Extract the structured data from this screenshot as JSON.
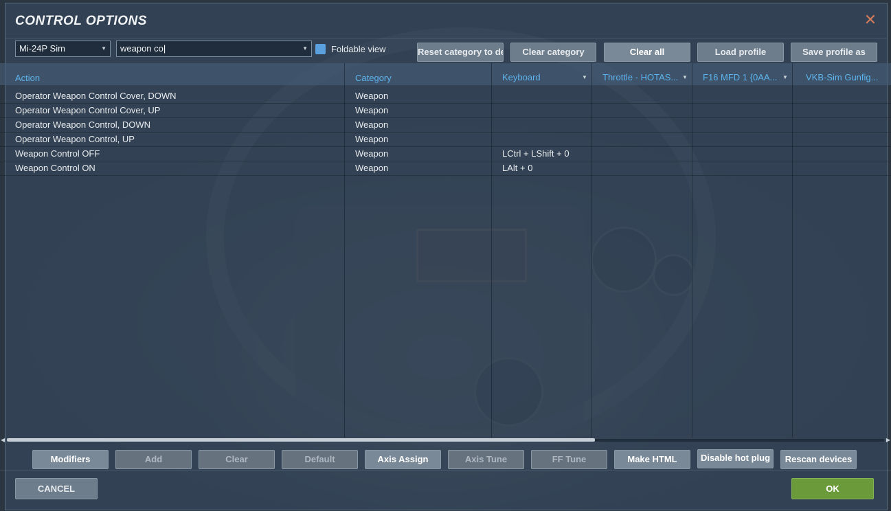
{
  "window": {
    "title": "CONTROL OPTIONS"
  },
  "toolbar": {
    "aircraft": "Mi-24P Sim",
    "search_value": "weapon co",
    "foldable_label": "Foldable view",
    "reset_category": "Reset category to default",
    "clear_category": "Clear category",
    "clear_all": "Clear all",
    "load_profile": "Load profile",
    "save_profile": "Save profile as"
  },
  "table": {
    "columns": [
      "Action",
      "Category",
      "Keyboard",
      "Throttle - HOTAS...",
      "F16 MFD 1 {0AA...",
      "VKB-Sim Gunfig..."
    ],
    "rows": [
      {
        "action": "Operator Weapon Control Cover, DOWN",
        "category": "Weapon",
        "keyboard": ""
      },
      {
        "action": "Operator Weapon Control Cover, UP",
        "category": "Weapon",
        "keyboard": ""
      },
      {
        "action": "Operator Weapon Control, DOWN",
        "category": "Weapon",
        "keyboard": ""
      },
      {
        "action": "Operator Weapon Control, UP",
        "category": "Weapon",
        "keyboard": ""
      },
      {
        "action": "Weapon Control OFF",
        "category": "Weapon",
        "keyboard": "LCtrl + LShift + 0"
      },
      {
        "action": "Weapon Control ON",
        "category": "Weapon",
        "keyboard": "LAlt + 0"
      }
    ]
  },
  "actions": {
    "modifiers": "Modifiers",
    "add": "Add",
    "clear": "Clear",
    "default": "Default",
    "axis_assign": "Axis Assign",
    "axis_tune": "Axis Tune",
    "ff_tune": "FF Tune",
    "make_html": "Make HTML",
    "disable_hot_plug": "Disable hot plug",
    "rescan_devices": "Rescan devices"
  },
  "footer": {
    "cancel": "CANCEL",
    "ok": "OK"
  },
  "colors": {
    "accent": "#5db4ee",
    "ok": "#6b9a3a",
    "cancel": "#6d7d8c",
    "close": "#d07a5a"
  },
  "icons": {
    "close": "close-icon",
    "dropdown": "chevron-down-icon"
  }
}
